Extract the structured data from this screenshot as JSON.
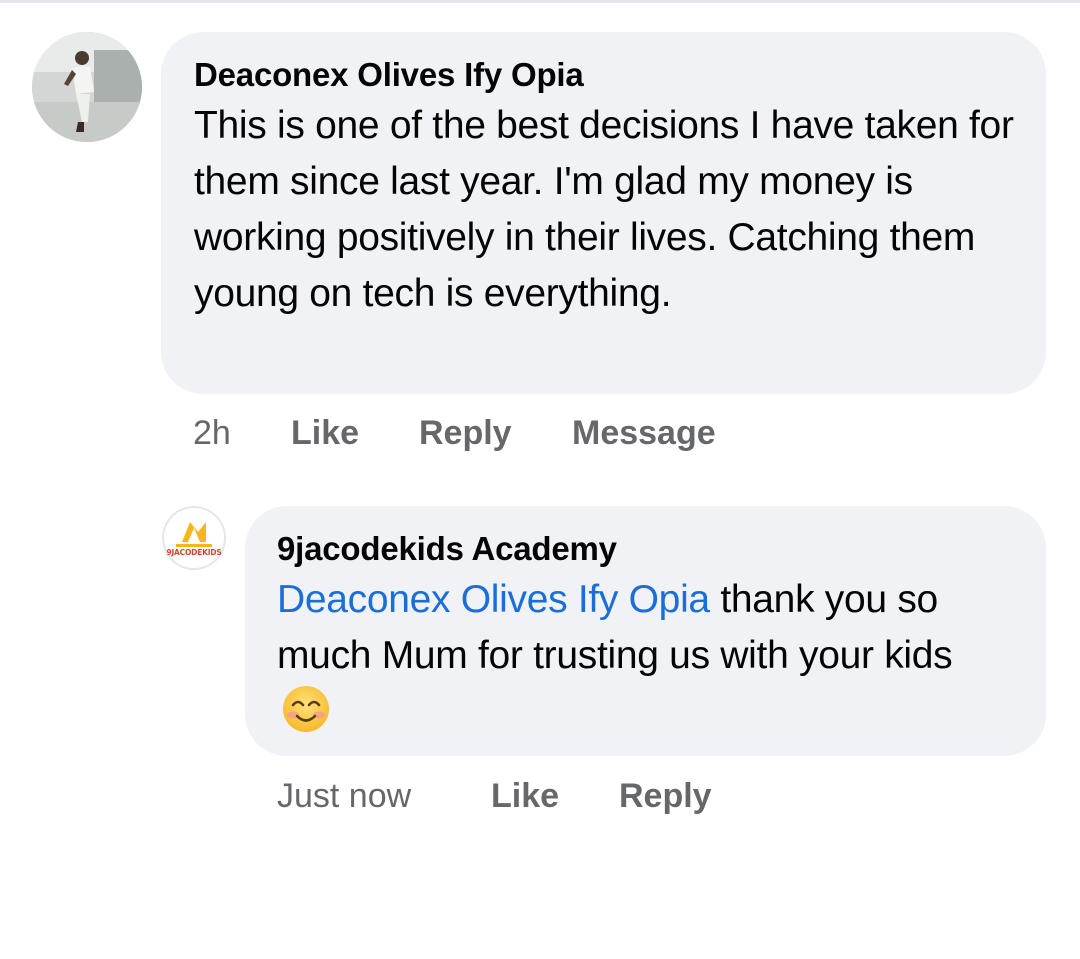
{
  "comment": {
    "author": "Deaconex Olives Ify Opia",
    "text": "This is one of the best decisions I have taken for them since last year. I'm glad my money is working positively in their lives. Catching them young on tech is everything.",
    "actions": {
      "time": "2h",
      "like": "Like",
      "reply": "Reply",
      "message": "Message"
    }
  },
  "reply": {
    "author": "9jacodekids Academy",
    "avatar_logo_text": "9JACODEKIDS",
    "mention": "Deaconex Olives Ify Opia",
    "text": " thank you so much Mum for trusting us with your kids ",
    "emoji": "smiling-face-emoji",
    "actions": {
      "time": "Just now",
      "like": "Like",
      "reply": "Reply"
    }
  },
  "colors": {
    "bubble": "#f0f2f5",
    "text": "#050505",
    "secondary_text": "#65676b",
    "mention": "#1a6ed8",
    "logo_yellow": "#f5b51c",
    "logo_red": "#d6452a"
  }
}
